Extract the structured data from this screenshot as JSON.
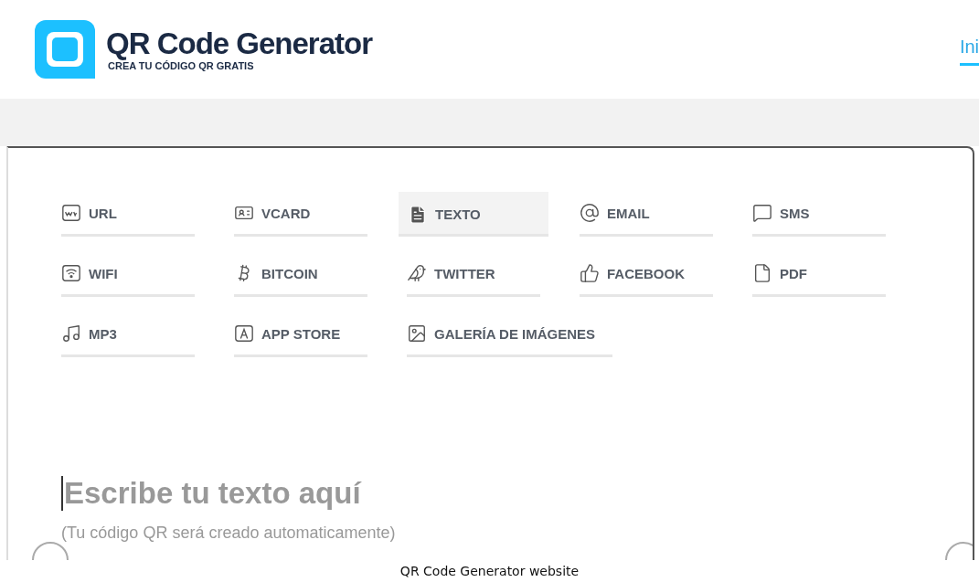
{
  "header": {
    "logo_title": "QR Code Generator",
    "logo_subtitle": "CREA TU CÓDIGO QR GRATIS",
    "nav_link": "Ini"
  },
  "types": [
    {
      "kind": "url",
      "label": "URL",
      "selected": false
    },
    {
      "kind": "vcard",
      "label": "VCARD",
      "selected": false
    },
    {
      "kind": "text",
      "label": "TEXTO",
      "selected": true
    },
    {
      "kind": "email",
      "label": "EMAIL",
      "selected": false
    },
    {
      "kind": "sms",
      "label": "SMS",
      "selected": false
    },
    {
      "kind": "wifi",
      "label": "WIFI",
      "selected": false
    },
    {
      "kind": "bitcoin",
      "label": "BITCOIN",
      "selected": false
    },
    {
      "kind": "twitter",
      "label": "TWITTER",
      "selected": false
    },
    {
      "kind": "facebook",
      "label": "FACEBOOK",
      "selected": false
    },
    {
      "kind": "pdf",
      "label": "PDF",
      "selected": false
    },
    {
      "kind": "mp3",
      "label": "MP3",
      "selected": false
    },
    {
      "kind": "appstore",
      "label": "APP STORE",
      "selected": false
    },
    {
      "kind": "gallery",
      "label": "GALERÍA DE IMÁGENES",
      "selected": false
    }
  ],
  "text_input": {
    "placeholder": "Escribe tu texto aquí",
    "hint": "(Tu código QR será creado automaticamente)"
  },
  "caption": "QR Code Generator website"
}
